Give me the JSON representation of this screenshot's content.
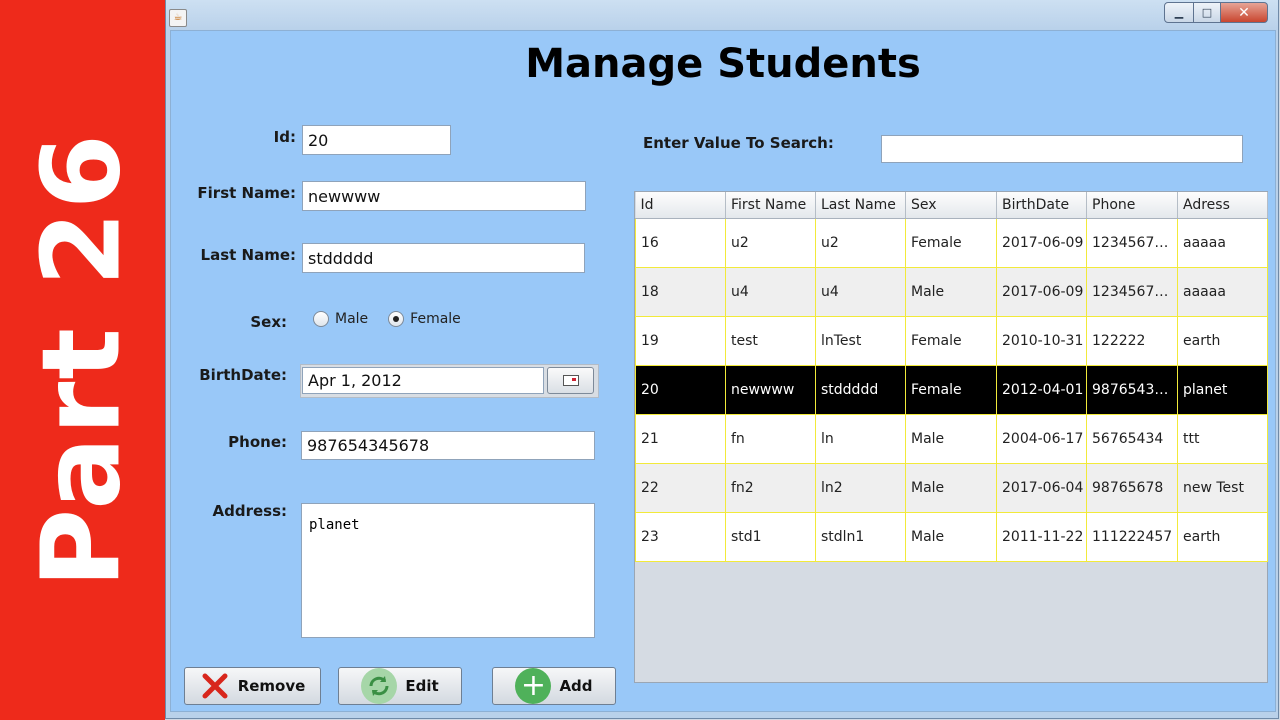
{
  "banner": {
    "text": "Part 26"
  },
  "window": {
    "icon": "java-app-icon",
    "controls": {
      "minimize": "▁",
      "maximize": "□",
      "close": "✕"
    }
  },
  "page": {
    "title": "Manage Students"
  },
  "form": {
    "id_label": "Id:",
    "id_value": "20",
    "first_name_label": "First Name:",
    "first_name_value": "newwww",
    "last_name_label": "Last Name:",
    "last_name_value": "stddddd",
    "sex_label": "Sex:",
    "sex_options": [
      "Male",
      "Female"
    ],
    "sex_selected": "Female",
    "birthdate_label": "BirthDate:",
    "birthdate_value": "Apr 1, 2012",
    "phone_label": "Phone:",
    "phone_value": "987654345678",
    "address_label": "Address:",
    "address_value": "planet"
  },
  "search": {
    "label": "Enter Value To Search:",
    "value": ""
  },
  "table": {
    "columns": [
      "Id",
      "First Name",
      "Last Name",
      "Sex",
      "BirthDate",
      "Phone",
      "Adress"
    ],
    "rows": [
      [
        "16",
        "u2",
        "u2",
        "Female",
        "2017-06-09",
        "12345678...",
        "aaaaa"
      ],
      [
        "18",
        "u4",
        "u4",
        "Male",
        "2017-06-09",
        "12345678...",
        "aaaaa"
      ],
      [
        "19",
        "test",
        "lnTest",
        "Female",
        "2010-10-31",
        "122222",
        "earth"
      ],
      [
        "20",
        "newwww",
        "stddddd",
        "Female",
        "2012-04-01",
        "98765434...",
        "planet"
      ],
      [
        "21",
        "fn",
        "ln",
        "Male",
        "2004-06-17",
        "56765434",
        "ttt"
      ],
      [
        "22",
        "fn2",
        "ln2",
        "Male",
        "2017-06-04",
        "98765678",
        "new Test"
      ],
      [
        "23",
        "std1",
        "stdln1",
        "Male",
        "2011-11-22",
        "111222457",
        "earth"
      ]
    ],
    "selected_row_id": "20"
  },
  "buttons": {
    "remove": "Remove",
    "edit": "Edit",
    "add": "Add"
  },
  "colors": {
    "banner": "#ee2a1b",
    "content_bg": "#99c8f8",
    "selected_row": "#000000",
    "grid_line": "#f2ea3a"
  }
}
